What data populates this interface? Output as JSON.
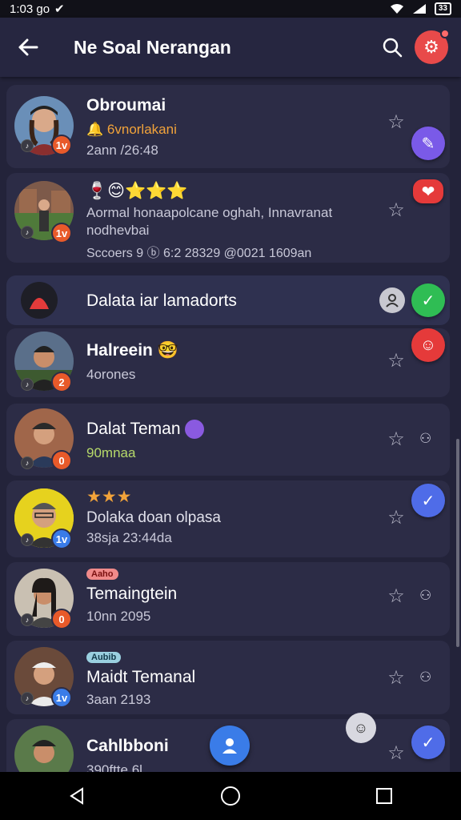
{
  "status_bar": {
    "time": "1:03 go",
    "battery": "33"
  },
  "header": {
    "title": "Ne Soal Nerangan"
  },
  "items": [
    {
      "name": "Obroumai",
      "sub1": "6vnorlakani",
      "sub2": "2ann /26:48",
      "badge": "1v"
    },
    {
      "name": "🍷😊⭐⭐⭐",
      "sub1": "Aormal honaapolcane oghah, Innavranat",
      "sub1b": "nodhevbai",
      "sub2": "Sccoers 9 ⓑ 6:2 28329 @0021 1609an",
      "badge": "1v"
    },
    {
      "name": "Dalata iar lamadorts"
    },
    {
      "name": "Halreein",
      "sub1": "4orones",
      "badge": "2"
    },
    {
      "name": "Dalat Teman",
      "sub1": "90mnaa",
      "badge": "0"
    },
    {
      "name": "Dolaka doan olpasa",
      "sub1": "38sja 23:44da",
      "badge": "1v"
    },
    {
      "tag": "Aaho",
      "name": "Temaingtein",
      "sub1": "10nn 2095",
      "badge": "0"
    },
    {
      "tag": "Aubib",
      "name": "Maidt Temanal",
      "sub1": "3aan 2193",
      "badge": "1v"
    },
    {
      "name": "Cahlbboni",
      "sub1": "390ftte 6l...."
    }
  ],
  "icons": {
    "back": "arrow-left-icon",
    "search": "search-icon",
    "settings": "gear-icon",
    "star": "star-outline-icon",
    "edit": "pencil-icon",
    "check": "check-icon",
    "person": "person-icon"
  },
  "colors": {
    "background": "#23233a",
    "card": "#2c2c46",
    "accent_purple": "#7a5ae8",
    "accent_blue": "#4f6ce8",
    "accent_red": "#e53a3a",
    "accent_green": "#2fbd54"
  }
}
